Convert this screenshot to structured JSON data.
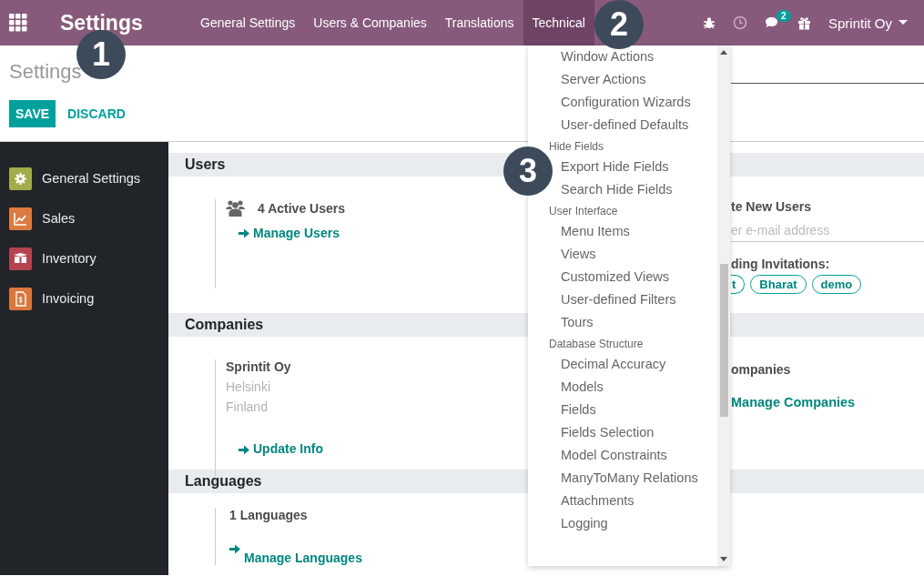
{
  "navbar": {
    "brand": "Settings",
    "menu": [
      {
        "label": "General Settings",
        "selected": false
      },
      {
        "label": "Users & Companies",
        "selected": false
      },
      {
        "label": "Translations",
        "selected": false
      },
      {
        "label": "Technical",
        "selected": true
      }
    ],
    "chat_count": "2",
    "user": "Sprintit Oy"
  },
  "control_panel": {
    "breadcrumb": "Settings",
    "buttons": [
      {
        "label": "SAVE",
        "kind": "primary"
      },
      {
        "label": "DISCARD",
        "kind": "secondary"
      }
    ]
  },
  "sidebar": {
    "items": [
      {
        "label": "General Settings",
        "kind": "gear",
        "color": "#a2ac4a"
      },
      {
        "label": "Sales",
        "kind": "chart",
        "color": "#dd7a3f"
      },
      {
        "label": "Inventory",
        "kind": "box",
        "color": "#b4434f"
      },
      {
        "label": "Invoicing",
        "kind": "invoice",
        "color": "#d9773c"
      }
    ]
  },
  "users": {
    "title": "Users",
    "count": "4 Active Users",
    "link": "Manage Users",
    "invite_title": "te New Users",
    "invite_placeholder": "er e-mail address",
    "pending_title": "ding Invitations:",
    "pending": [
      "t",
      "Bharat",
      "demo"
    ]
  },
  "companies": {
    "title": "Companies",
    "name": "Sprintit Oy",
    "city": "Helsinki",
    "country": "Finland",
    "link": "Update Info",
    "right_title": "ompanies",
    "right_link": "Manage Companies"
  },
  "languages": {
    "title": "Languages",
    "count": "1 Languages",
    "link": "Manage Languages"
  },
  "dropdown": {
    "entries": [
      {
        "label": "Window Actions",
        "kind": "item"
      },
      {
        "label": "Server Actions",
        "kind": "item"
      },
      {
        "label": "Configuration Wizards",
        "kind": "item"
      },
      {
        "label": "User-defined Defaults",
        "kind": "item"
      },
      {
        "label": "Hide Fields",
        "kind": "header"
      },
      {
        "label": "Export Hide Fields",
        "kind": "item"
      },
      {
        "label": "Search Hide Fields",
        "kind": "item"
      },
      {
        "label": "User Interface",
        "kind": "header"
      },
      {
        "label": "Menu Items",
        "kind": "item"
      },
      {
        "label": "Views",
        "kind": "item"
      },
      {
        "label": "Customized Views",
        "kind": "item"
      },
      {
        "label": "User-defined Filters",
        "kind": "item"
      },
      {
        "label": "Tours",
        "kind": "item"
      },
      {
        "label": "Database Structure",
        "kind": "header"
      },
      {
        "label": "Decimal Accuracy",
        "kind": "item"
      },
      {
        "label": "Models",
        "kind": "item"
      },
      {
        "label": "Fields",
        "kind": "item"
      },
      {
        "label": "Fields Selection",
        "kind": "item"
      },
      {
        "label": "Model Constraints",
        "kind": "item"
      },
      {
        "label": "ManyToMany Relations",
        "kind": "item"
      },
      {
        "label": "Attachments",
        "kind": "item"
      },
      {
        "label": "Logging",
        "kind": "item"
      }
    ]
  },
  "annotations": [
    "1",
    "2",
    "3"
  ]
}
